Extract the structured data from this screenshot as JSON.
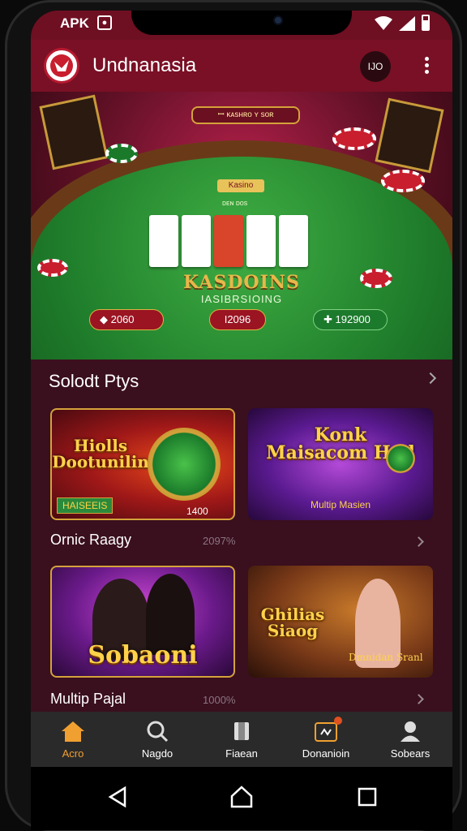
{
  "status_bar": {
    "carrier": "APK",
    "badge": "●"
  },
  "app_bar": {
    "title": "Undnanasia",
    "profile_label": "IJO"
  },
  "hero": {
    "sign": "ꟷ ᴋᴀsʜʀᴏ ʏ sᴏʀ",
    "kasino": "Kasino",
    "small": "ᴅᴇɴ  ᴅᴏs",
    "title": "KASDOINS",
    "subtitle": "IASIBRSIOING",
    "pills": [
      "2060",
      "I2096",
      "192900"
    ]
  },
  "section": {
    "title": "Solodt Ptys"
  },
  "games": [
    {
      "title": "Hiolls Dootunilin",
      "sub": "HAISEEIS",
      "meta": "1400",
      "row_label": "Ornic Raagy",
      "row_meta": "2097%"
    },
    {
      "title": "Konk Maisacom Hod",
      "sub": "Multip Masien",
      "meta": ""
    },
    {
      "title": "Sobaoni",
      "sub": "",
      "meta": "",
      "row_label": "Multip Pajal",
      "row_meta": "1000%"
    },
    {
      "title": "Ghilias Siaog",
      "sub": "Dmnidan Sranl",
      "meta": ""
    }
  ],
  "bottom_nav": [
    {
      "label": "Acro",
      "icon": "home-icon",
      "active": true
    },
    {
      "label": "Nagdo",
      "icon": "search-icon",
      "active": false
    },
    {
      "label": "Fiaean",
      "icon": "cards-icon",
      "active": false
    },
    {
      "label": "Donanioin",
      "icon": "gift-icon",
      "active": false
    },
    {
      "label": "Sobears",
      "icon": "person-icon",
      "active": false
    }
  ],
  "colors": {
    "brand": "#7a1025",
    "accent": "#f0a030",
    "background": "#3a0f1e"
  }
}
